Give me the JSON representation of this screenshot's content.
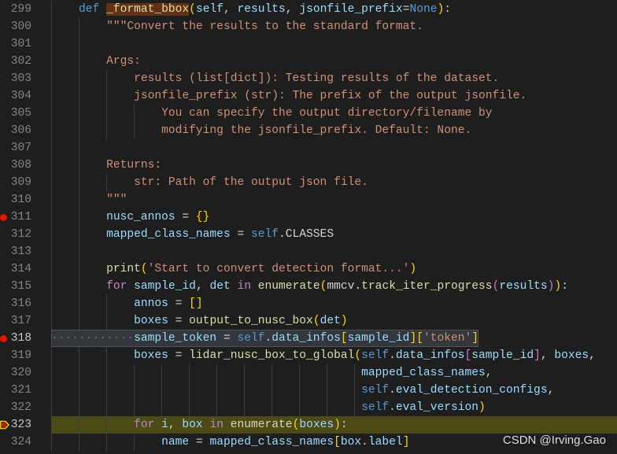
{
  "editor": {
    "theme": {
      "background": "#1e1e1e",
      "line_number": "#858585",
      "line_number_active": "#c6c6c6",
      "breakpoint": "#e51400",
      "debug_arrow": "#ffcc00",
      "current_line": "#4b4b18",
      "selection": "#33363b",
      "selection_border": "#4e5157",
      "find_match": "#613214",
      "indent_guide": "#404040",
      "whitespace": "#6e6e6e",
      "watermark_text": "#f0f0f0"
    },
    "lines": [
      {
        "n": "299",
        "tokens": [
          [
            "    ",
            "#d4d4d4"
          ],
          [
            "def",
            "#569cd6"
          ],
          [
            " ",
            "#d4d4d4"
          ],
          [
            "_format_bbox",
            "#dcdcaa",
            true
          ],
          [
            "(",
            "#ffd700"
          ],
          [
            "self",
            "#9cdcfe"
          ],
          [
            ", ",
            "#d4d4d4"
          ],
          [
            "results",
            "#9cdcfe"
          ],
          [
            ", ",
            "#d4d4d4"
          ],
          [
            "jsonfile_prefix",
            "#9cdcfe"
          ],
          [
            "=",
            "#d4d4d4"
          ],
          [
            "None",
            "#569cd6"
          ],
          [
            ")",
            "#ffd700"
          ],
          [
            ":",
            "#d4d4d4"
          ]
        ]
      },
      {
        "n": "300",
        "tokens": [
          [
            "        ",
            "#d4d4d4"
          ],
          [
            "\"\"\"Convert the results to the standard format.",
            "#ce9178"
          ]
        ]
      },
      {
        "n": "301",
        "tokens": []
      },
      {
        "n": "302",
        "tokens": [
          [
            "        ",
            "#d4d4d4"
          ],
          [
            "Args:",
            "#ce9178"
          ]
        ]
      },
      {
        "n": "303",
        "tokens": [
          [
            "            ",
            "#d4d4d4"
          ],
          [
            "results (list[dict]): Testing results of the dataset.",
            "#ce9178"
          ]
        ]
      },
      {
        "n": "304",
        "tokens": [
          [
            "            ",
            "#d4d4d4"
          ],
          [
            "jsonfile_prefix (str): The prefix of the output jsonfile.",
            "#ce9178"
          ]
        ]
      },
      {
        "n": "305",
        "tokens": [
          [
            "                ",
            "#d4d4d4"
          ],
          [
            "You can specify the output directory/filename by",
            "#ce9178"
          ]
        ]
      },
      {
        "n": "306",
        "tokens": [
          [
            "                ",
            "#d4d4d4"
          ],
          [
            "modifying the jsonfile_prefix. Default: None.",
            "#ce9178"
          ]
        ]
      },
      {
        "n": "307",
        "tokens": []
      },
      {
        "n": "308",
        "tokens": [
          [
            "        ",
            "#d4d4d4"
          ],
          [
            "Returns:",
            "#ce9178"
          ]
        ]
      },
      {
        "n": "309",
        "tokens": [
          [
            "            ",
            "#d4d4d4"
          ],
          [
            "str: Path of the output json file.",
            "#ce9178"
          ]
        ]
      },
      {
        "n": "310",
        "tokens": [
          [
            "        ",
            "#d4d4d4"
          ],
          [
            "\"\"\"",
            "#ce9178"
          ]
        ]
      },
      {
        "n": "311",
        "breakpoint": true,
        "tokens": [
          [
            "        ",
            "#d4d4d4"
          ],
          [
            "nusc_annos",
            "#9cdcfe"
          ],
          [
            " = ",
            "#d4d4d4"
          ],
          [
            "{}",
            "#ffd700"
          ]
        ]
      },
      {
        "n": "312",
        "tokens": [
          [
            "        ",
            "#d4d4d4"
          ],
          [
            "mapped_class_names",
            "#9cdcfe"
          ],
          [
            " = ",
            "#d4d4d4"
          ],
          [
            "self",
            "#569cd6"
          ],
          [
            ".CLASSES",
            "#d4d4d4"
          ]
        ]
      },
      {
        "n": "313",
        "tokens": []
      },
      {
        "n": "314",
        "tokens": [
          [
            "        ",
            "#d4d4d4"
          ],
          [
            "print",
            "#dcdcaa"
          ],
          [
            "(",
            "#ffd700"
          ],
          [
            "'Start to convert detection format...'",
            "#ce9178"
          ],
          [
            ")",
            "#ffd700"
          ]
        ]
      },
      {
        "n": "315",
        "tokens": [
          [
            "        ",
            "#d4d4d4"
          ],
          [
            "for",
            "#c586c0"
          ],
          [
            " ",
            "#d4d4d4"
          ],
          [
            "sample_id",
            "#9cdcfe"
          ],
          [
            ", ",
            "#d4d4d4"
          ],
          [
            "det",
            "#9cdcfe"
          ],
          [
            " ",
            "#d4d4d4"
          ],
          [
            "in",
            "#c586c0"
          ],
          [
            " ",
            "#d4d4d4"
          ],
          [
            "enumerate",
            "#dcdcaa"
          ],
          [
            "(",
            "#ffd700"
          ],
          [
            "mmcv.",
            "#d4d4d4"
          ],
          [
            "track_iter_progress",
            "#dcdcaa"
          ],
          [
            "(",
            "#da70d6"
          ],
          [
            "results",
            "#9cdcfe"
          ],
          [
            ")",
            "#da70d6"
          ],
          [
            ")",
            "#ffd700"
          ],
          [
            ":",
            "#d4d4d4"
          ]
        ]
      },
      {
        "n": "316",
        "tokens": [
          [
            "            ",
            "#d4d4d4"
          ],
          [
            "annos",
            "#9cdcfe"
          ],
          [
            " = ",
            "#d4d4d4"
          ],
          [
            "[]",
            "#ffd700"
          ]
        ]
      },
      {
        "n": "317",
        "tokens": [
          [
            "            ",
            "#d4d4d4"
          ],
          [
            "boxes",
            "#9cdcfe"
          ],
          [
            " = ",
            "#d4d4d4"
          ],
          [
            "output_to_nusc_box",
            "#dcdcaa"
          ],
          [
            "(",
            "#ffd700"
          ],
          [
            "det",
            "#9cdcfe"
          ],
          [
            ")",
            "#ffd700"
          ]
        ]
      },
      {
        "n": "318",
        "breakpoint": true,
        "selected": true,
        "tokens": [
          [
            "            ",
            "#d4d4d4"
          ],
          [
            "sample_token",
            "#9cdcfe"
          ],
          [
            " = ",
            "#d4d4d4"
          ],
          [
            "self",
            "#569cd6"
          ],
          [
            ".",
            "#d4d4d4"
          ],
          [
            "data_infos",
            "#9cdcfe"
          ],
          [
            "[",
            "#ffd700"
          ],
          [
            "sample_id",
            "#9cdcfe"
          ],
          [
            "]",
            "#ffd700"
          ],
          [
            "[",
            "#ffd700"
          ],
          [
            "'token'",
            "#ce9178"
          ],
          [
            "]",
            "#ffd700"
          ]
        ]
      },
      {
        "n": "319",
        "tokens": [
          [
            "            ",
            "#d4d4d4"
          ],
          [
            "boxes",
            "#9cdcfe"
          ],
          [
            " = ",
            "#d4d4d4"
          ],
          [
            "lidar_nusc_box_to_global",
            "#dcdcaa"
          ],
          [
            "(",
            "#ffd700"
          ],
          [
            "self",
            "#569cd6"
          ],
          [
            ".",
            "#d4d4d4"
          ],
          [
            "data_infos",
            "#9cdcfe"
          ],
          [
            "[",
            "#da70d6"
          ],
          [
            "sample_id",
            "#9cdcfe"
          ],
          [
            "]",
            "#da70d6"
          ],
          [
            ", ",
            "#d4d4d4"
          ],
          [
            "boxes",
            "#9cdcfe"
          ],
          [
            ",",
            "#d4d4d4"
          ]
        ]
      },
      {
        "n": "320",
        "tokens": [
          [
            "                                             ",
            "#d4d4d4"
          ],
          [
            "mapped_class_names",
            "#9cdcfe"
          ],
          [
            ",",
            "#d4d4d4"
          ]
        ]
      },
      {
        "n": "321",
        "tokens": [
          [
            "                                             ",
            "#d4d4d4"
          ],
          [
            "self",
            "#569cd6"
          ],
          [
            ".",
            "#d4d4d4"
          ],
          [
            "eval_detection_configs",
            "#9cdcfe"
          ],
          [
            ",",
            "#d4d4d4"
          ]
        ]
      },
      {
        "n": "322",
        "tokens": [
          [
            "                                             ",
            "#d4d4d4"
          ],
          [
            "self",
            "#569cd6"
          ],
          [
            ".",
            "#d4d4d4"
          ],
          [
            "eval_version",
            "#9cdcfe"
          ],
          [
            ")",
            "#ffd700"
          ]
        ]
      },
      {
        "n": "323",
        "paused": true,
        "current": true,
        "tokens": [
          [
            "            ",
            "#d4d4d4"
          ],
          [
            "for",
            "#c586c0"
          ],
          [
            " ",
            "#d4d4d4"
          ],
          [
            "i",
            "#9cdcfe"
          ],
          [
            ", ",
            "#d4d4d4"
          ],
          [
            "box",
            "#9cdcfe"
          ],
          [
            " ",
            "#d4d4d4"
          ],
          [
            "in",
            "#c586c0"
          ],
          [
            " ",
            "#d4d4d4"
          ],
          [
            "enumerate",
            "#dcdcaa"
          ],
          [
            "(",
            "#ffd700"
          ],
          [
            "boxes",
            "#9cdcfe"
          ],
          [
            ")",
            "#ffd700"
          ],
          [
            ":",
            "#d4d4d4"
          ]
        ]
      },
      {
        "n": "324",
        "tokens": [
          [
            "                ",
            "#d4d4d4"
          ],
          [
            "name",
            "#9cdcfe"
          ],
          [
            " = ",
            "#d4d4d4"
          ],
          [
            "mapped_class_names",
            "#9cdcfe"
          ],
          [
            "[",
            "#ffd700"
          ],
          [
            "box",
            "#9cdcfe"
          ],
          [
            ".",
            "#d4d4d4"
          ],
          [
            "label",
            "#9cdcfe"
          ],
          [
            "]",
            "#ffd700"
          ]
        ]
      }
    ]
  },
  "watermark": "CSDN @Irving.Gao"
}
